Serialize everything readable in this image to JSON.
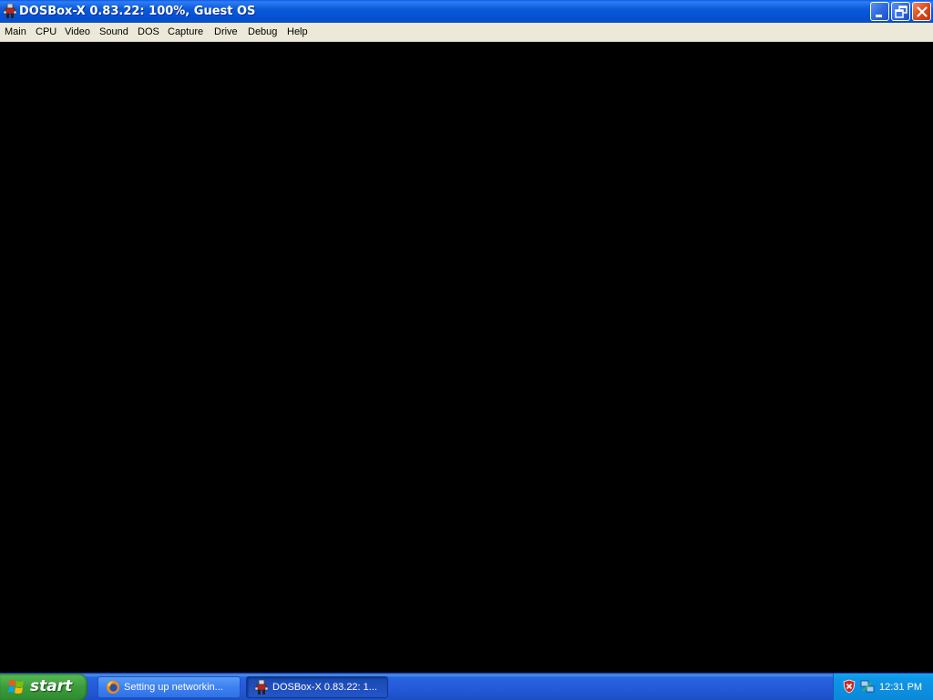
{
  "window": {
    "title": "DOSBox-X 0.83.22: 100%, Guest OS",
    "icon": "dosbox-icon",
    "controls": [
      "minimize-icon",
      "restore-icon",
      "close-icon"
    ]
  },
  "menu": {
    "items": [
      {
        "label": "Main"
      },
      {
        "label": "CPU"
      },
      {
        "label": "Video"
      },
      {
        "label": "Sound"
      },
      {
        "label": "DOS"
      },
      {
        "label": "Capture"
      },
      {
        "label": "Drive"
      },
      {
        "label": "Debug"
      },
      {
        "label": "Help"
      }
    ]
  },
  "taskbar": {
    "start_label": "start",
    "tasks": [
      {
        "label": "Setting up networkin...",
        "icon": "firefox-icon",
        "active": false
      },
      {
        "label": "DOSBox-X 0.83.22: 1...",
        "icon": "dosbox-icon",
        "active": true
      }
    ],
    "tray": {
      "icons": [
        "security-shield-icon",
        "network-icon"
      ],
      "clock": "12:31 PM"
    }
  },
  "colors": {
    "title_bar": "#0452d6",
    "menu_bar": "#ece9d8",
    "display": "#000000",
    "taskbar": "#2459d6",
    "start_button": "#3b9b3b",
    "tray": "#0b87d8"
  }
}
